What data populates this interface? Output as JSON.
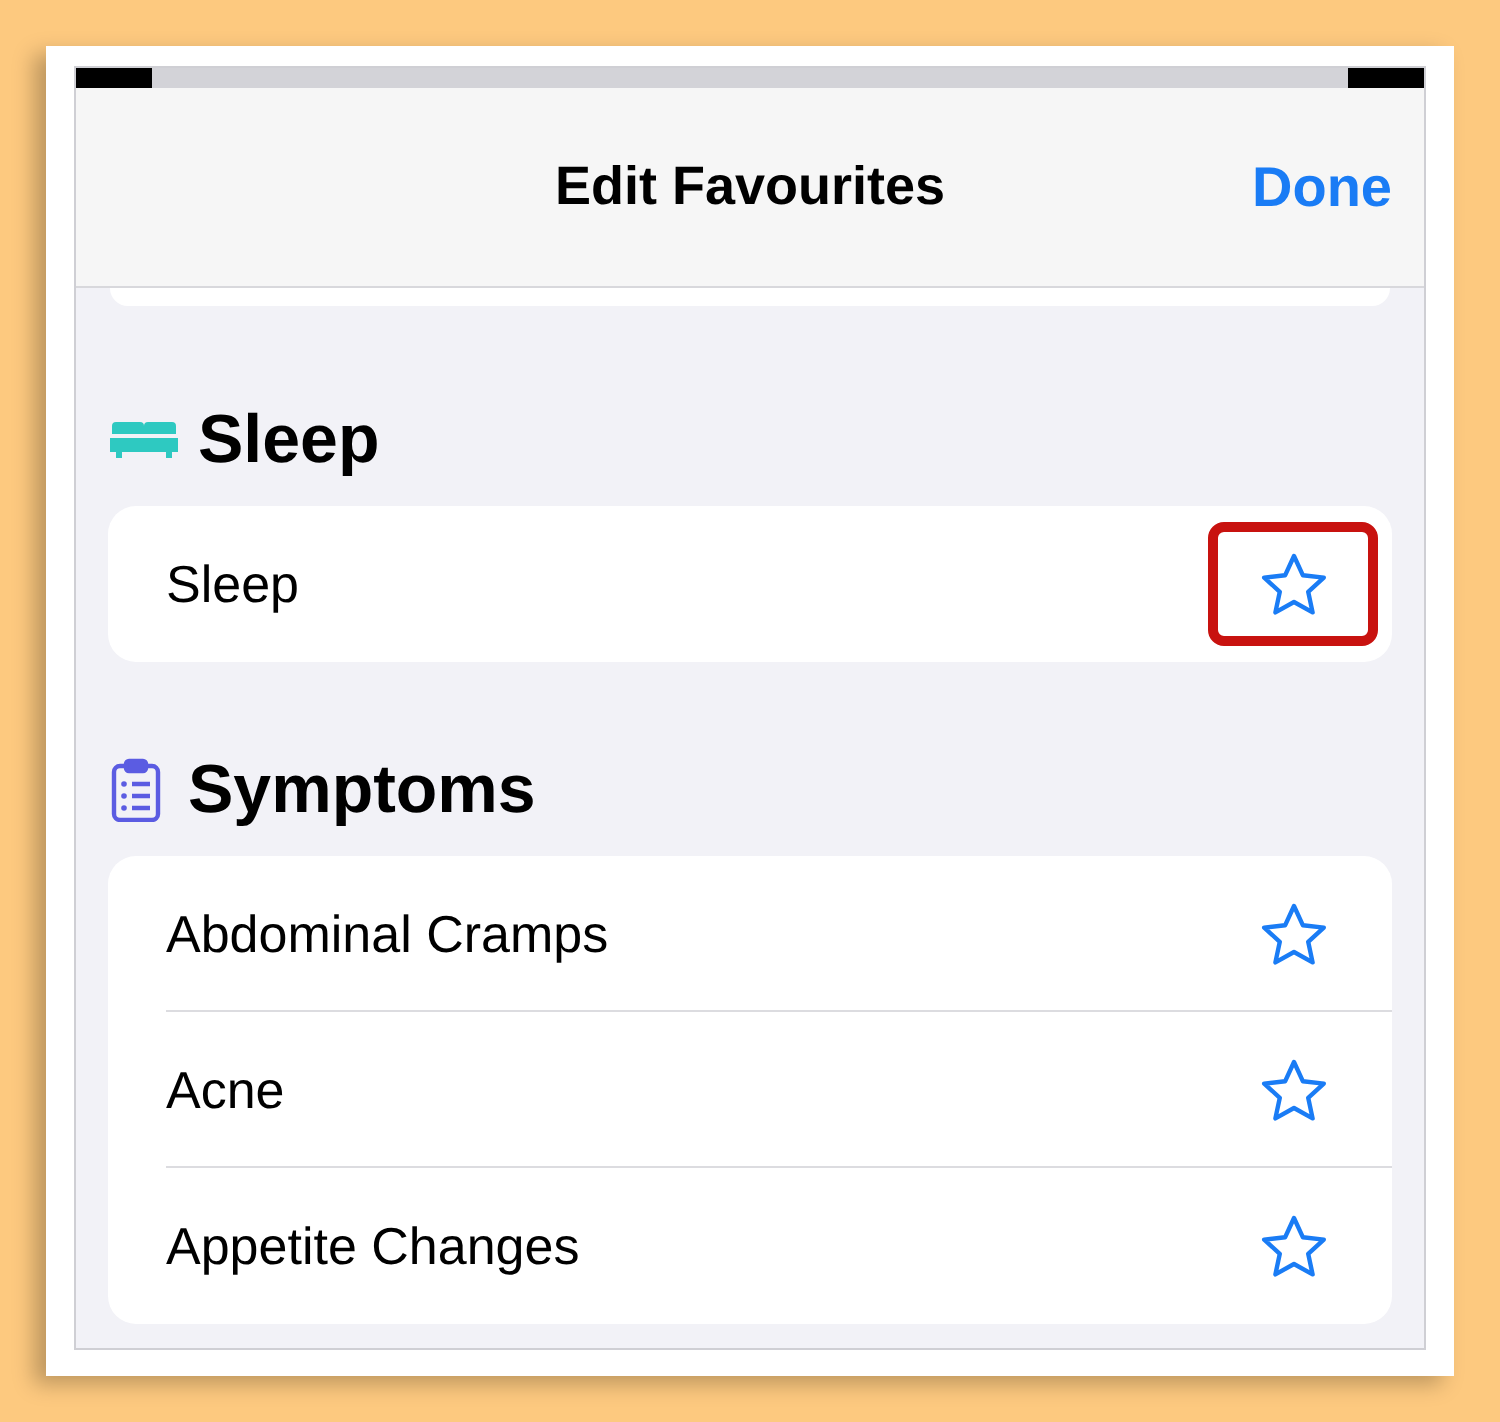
{
  "nav_bar": {
    "title": "Edit Favourites",
    "done_button": "Done"
  },
  "sections": [
    {
      "kind": "sleep",
      "title": "Sleep",
      "items": [
        {
          "label": "Sleep",
          "favourite": false,
          "highlighted": true
        }
      ]
    },
    {
      "kind": "symptoms",
      "title": "Symptoms",
      "items": [
        {
          "label": "Abdominal Cramps",
          "favourite": false,
          "highlighted": false
        },
        {
          "label": "Acne",
          "favourite": false,
          "highlighted": false
        },
        {
          "label": "Appetite Changes",
          "favourite": false,
          "highlighted": false
        }
      ]
    }
  ]
}
